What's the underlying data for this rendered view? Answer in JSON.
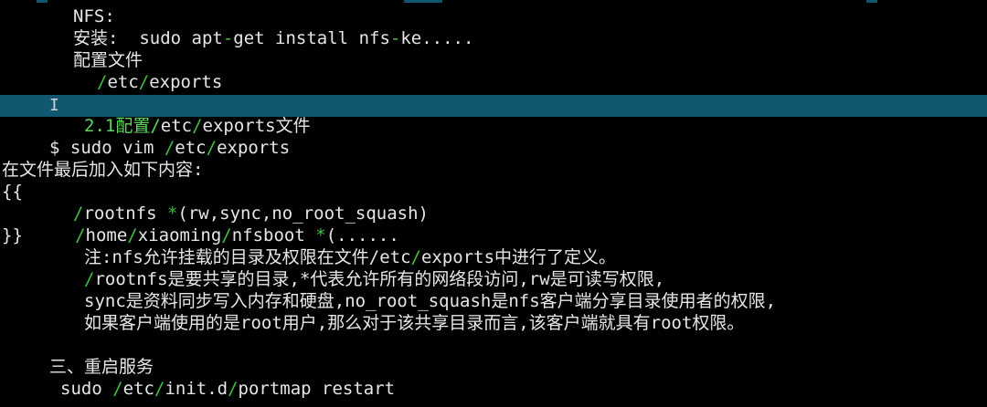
{
  "lines": [
    {
      "indent": 80,
      "parts": [
        {
          "t": "NFS:",
          "c": "w"
        }
      ]
    },
    {
      "indent": 80,
      "parts": [
        {
          "t": "安装:  sudo apt",
          "c": "w"
        },
        {
          "t": "-",
          "c": "g"
        },
        {
          "t": "get install nfs",
          "c": "w"
        },
        {
          "t": "-",
          "c": "g"
        },
        {
          "t": "ke.....",
          "c": "w"
        }
      ]
    },
    {
      "indent": 80,
      "parts": [
        {
          "t": "配置文件",
          "c": "w"
        }
      ]
    },
    {
      "indent": 106,
      "parts": [
        {
          "t": "/",
          "c": "g"
        },
        {
          "t": "etc",
          "c": "w"
        },
        {
          "t": "/",
          "c": "g"
        },
        {
          "t": "exports",
          "c": "w"
        }
      ]
    },
    {
      "indent": 0,
      "parts": []
    },
    {
      "indent": 92,
      "parts": [
        {
          "t": "2.1配置/",
          "c": "G"
        },
        {
          "t": "etc",
          "c": "w"
        },
        {
          "t": "/",
          "c": "g"
        },
        {
          "t": "exports文件",
          "c": "w"
        }
      ]
    },
    {
      "indent": 54,
      "parts": [
        {
          "t": "$ sudo vim ",
          "c": "w"
        },
        {
          "t": "/",
          "c": "g"
        },
        {
          "t": "etc",
          "c": "w"
        },
        {
          "t": "/",
          "c": "g"
        },
        {
          "t": "exports",
          "c": "w"
        }
      ]
    },
    {
      "indent": 2,
      "parts": [
        {
          "t": "在文件最后加入如下内容:",
          "c": "w"
        }
      ]
    },
    {
      "indent": 2,
      "parts": [
        {
          "t": "{{",
          "c": "w"
        }
      ]
    },
    {
      "indent": 80,
      "parts": [
        {
          "t": "/",
          "c": "g"
        },
        {
          "t": "rootnfs ",
          "c": "w"
        },
        {
          "t": "*",
          "c": "g"
        },
        {
          "t": "(rw,sync,no_root_squash)",
          "c": "w"
        }
      ]
    },
    {
      "indent": 2,
      "parts": [
        {
          "t": "}}     ",
          "c": "w"
        },
        {
          "t": "/",
          "c": "g"
        },
        {
          "t": "home",
          "c": "w"
        },
        {
          "t": "/",
          "c": "g"
        },
        {
          "t": "xiaoming",
          "c": "w"
        },
        {
          "t": "/",
          "c": "g"
        },
        {
          "t": "nfsboot ",
          "c": "w"
        },
        {
          "t": "*",
          "c": "g"
        },
        {
          "t": "(......",
          "c": "w"
        }
      ]
    },
    {
      "indent": 92,
      "parts": [
        {
          "t": "注:nfs允许挂载的目录及权限在文件/",
          "c": "w"
        },
        {
          "t": "etc",
          "c": "w"
        },
        {
          "t": "/",
          "c": "g"
        },
        {
          "t": "exports中进行了定义。",
          "c": "w"
        }
      ]
    },
    {
      "indent": 92,
      "parts": [
        {
          "t": "/",
          "c": "g"
        },
        {
          "t": "rootnfs是要共享的目录,*代表允许所有的网络段访问,rw是可读写权限,",
          "c": "w"
        }
      ]
    },
    {
      "indent": 92,
      "parts": [
        {
          "t": "sync是资料同步写入内存和硬盘,no_root_squash是nfs客户端分享目录使用者的权限,",
          "c": "w"
        }
      ]
    },
    {
      "indent": 92,
      "parts": [
        {
          "t": "如果客户端使用的是root用户,那么对于该共享目录而言,该客户端就具有root权限。",
          "c": "w"
        }
      ]
    },
    {
      "indent": 0,
      "parts": []
    },
    {
      "indent": 54,
      "parts": [
        {
          "t": "三、重启服务",
          "c": "w"
        }
      ]
    },
    {
      "indent": 66,
      "parts": [
        {
          "t": "sudo ",
          "c": "w"
        },
        {
          "t": "/",
          "c": "g"
        },
        {
          "t": "etc",
          "c": "w"
        },
        {
          "t": "/",
          "c": "g"
        },
        {
          "t": "init.d",
          "c": "w"
        },
        {
          "t": "/",
          "c": "g"
        },
        {
          "t": "portmap restart",
          "c": "w"
        }
      ]
    }
  ],
  "cursor_line_index": 4,
  "caret_glyph": "I",
  "colors": {
    "background": "#000000",
    "text": "#e6e6e6",
    "operator": "#3fbf3f",
    "heading_green": "#5ed65e",
    "cursorline": "#0f5870"
  }
}
